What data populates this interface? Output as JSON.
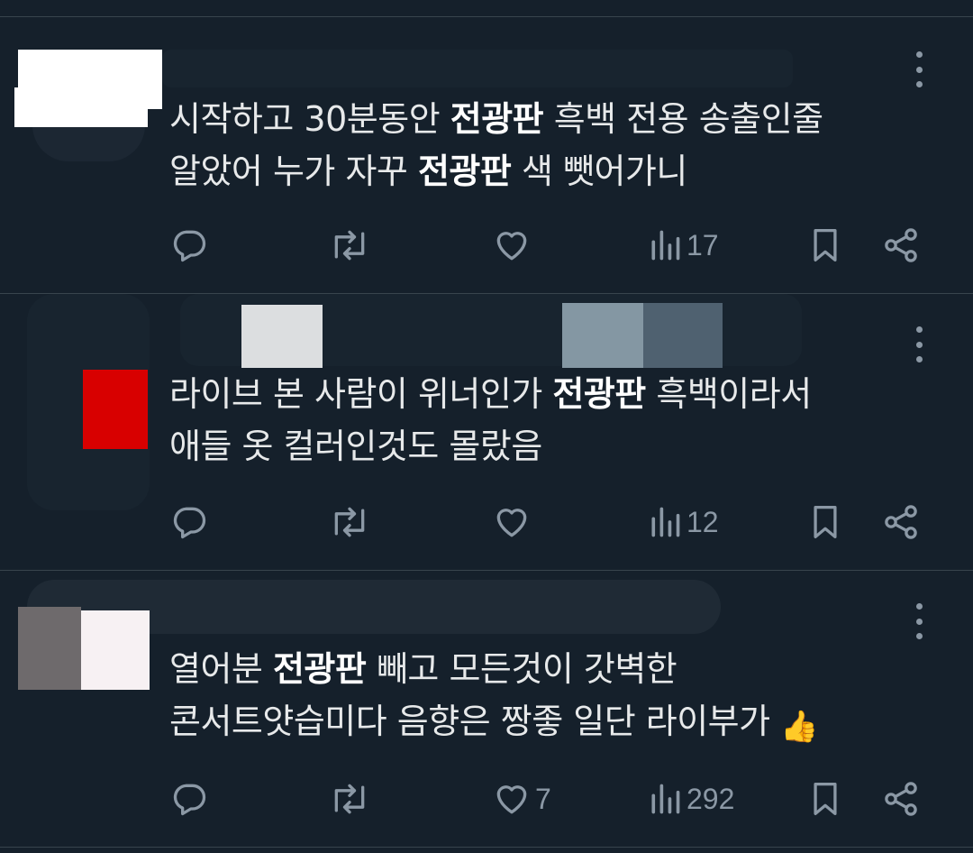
{
  "tweets": [
    {
      "segments": [
        {
          "text": "시작하고 30분동안 ",
          "bold": false
        },
        {
          "text": "전광판",
          "bold": true
        },
        {
          "text": " 흑백 전용 송출인줄",
          "bold": false
        }
      ],
      "segments2": [
        {
          "text": "알았어 누가 자꾸 ",
          "bold": false
        },
        {
          "text": "전광판",
          "bold": true
        },
        {
          "text": " 색 뺏어가니",
          "bold": false
        }
      ],
      "views": "17",
      "likes": ""
    },
    {
      "segments": [
        {
          "text": "라이브 본 사람이 위너인가 ",
          "bold": false
        },
        {
          "text": "전광판",
          "bold": true
        },
        {
          "text": " 흑백이라서",
          "bold": false
        }
      ],
      "segments2": [
        {
          "text": "애들 옷 컬러인것도 몰랐음",
          "bold": false
        }
      ],
      "views": "12",
      "likes": ""
    },
    {
      "segments": [
        {
          "text": "열어분 ",
          "bold": false
        },
        {
          "text": "전광판",
          "bold": true
        },
        {
          "text": " 빼고 모든것이 갓벽한",
          "bold": false
        }
      ],
      "segments2": [
        {
          "text": "콘서트얏습미다 음향은 짱좋 일단 라이부가 ",
          "bold": false
        }
      ],
      "emoji": "👍",
      "views": "292",
      "likes": "7"
    }
  ],
  "icons": {
    "reply": "reply-icon",
    "retweet": "retweet-icon",
    "like": "heart-icon",
    "views": "views-icon",
    "bookmark": "bookmark-icon",
    "share": "share-icon",
    "more": "more-icon"
  },
  "colors": {
    "background": "#15202b",
    "text": "#e7e9ea",
    "icon": "#8b98a5",
    "divider": "#38444d"
  }
}
